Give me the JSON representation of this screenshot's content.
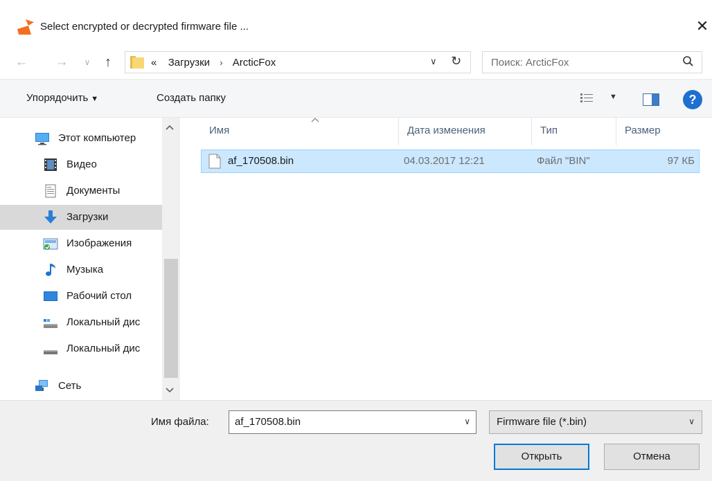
{
  "window": {
    "title": "Select encrypted or decrypted firmware file ...",
    "close_glyph": "✕"
  },
  "nav": {
    "back_glyph": "←",
    "forward_glyph": "→",
    "recent_glyph": "∨",
    "up_glyph": "↑"
  },
  "address": {
    "overflow": "«",
    "crumbs": [
      "Загрузки",
      "ArcticFox"
    ],
    "separator": "›",
    "dropdown_glyph": "∨",
    "refresh_glyph": "↻"
  },
  "search": {
    "placeholder": "Поиск: ArcticFox",
    "icon": "search-icon"
  },
  "toolbar": {
    "organize_label": "Упорядочить",
    "caret": "▼",
    "new_folder_label": "Создать папку",
    "help_glyph": "?"
  },
  "sidebar": {
    "items": [
      {
        "label": "Этот компьютер",
        "icon": "computer-icon"
      },
      {
        "label": "Видео",
        "icon": "video-icon"
      },
      {
        "label": "Документы",
        "icon": "documents-icon"
      },
      {
        "label": "Загрузки",
        "icon": "downloads-icon",
        "selected": true
      },
      {
        "label": "Изображения",
        "icon": "pictures-icon"
      },
      {
        "label": "Музыка",
        "icon": "music-icon"
      },
      {
        "label": "Рабочий стол",
        "icon": "desktop-icon"
      },
      {
        "label": "Локальный дис",
        "icon": "local-disk-icon"
      },
      {
        "label": "Локальный дис",
        "icon": "local-disk-icon"
      },
      {
        "label": "Сеть",
        "icon": "network-icon"
      }
    ]
  },
  "columns": {
    "name": "Имя",
    "date": "Дата изменения",
    "type": "Тип",
    "size": "Размер"
  },
  "files": [
    {
      "name": "af_170508.bin",
      "date": "04.03.2017 12:21",
      "type": "Файл \"BIN\"",
      "size": "97 КБ"
    }
  ],
  "footer": {
    "filename_label": "Имя файла:",
    "filename_value": "af_170508.bin",
    "filetype_value": "Firmware file (*.bin)",
    "dropdown_glyph": "∨",
    "open_label": "Открыть",
    "cancel_label": "Отмена"
  },
  "colors": {
    "accent": "#0078d7",
    "selection_bg": "#cce8ff",
    "selection_border": "#99d1ff",
    "help_blue": "#1f6fd1"
  }
}
